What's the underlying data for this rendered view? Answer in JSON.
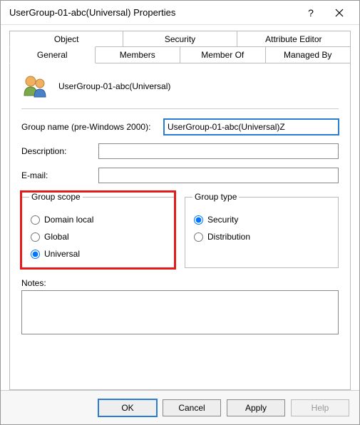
{
  "window": {
    "title": "UserGroup-01-abc(Universal) Properties",
    "help_glyph": "?",
    "close_glyph": "×"
  },
  "tabs": {
    "row1": [
      "Object",
      "Security",
      "Attribute Editor"
    ],
    "row2": [
      "General",
      "Members",
      "Member Of",
      "Managed By"
    ],
    "active": "General"
  },
  "header": {
    "display_name": "UserGroup-01-abc(Universal)"
  },
  "fields": {
    "group_name_label": "Group name (pre-Windows 2000):",
    "group_name_value": "UserGroup-01-abc(Universal)Z",
    "description_label": "Description:",
    "description_value": "",
    "email_label": "E-mail:",
    "email_value": ""
  },
  "scope": {
    "legend": "Group scope",
    "options": [
      "Domain local",
      "Global",
      "Universal"
    ],
    "selected": "Universal"
  },
  "type": {
    "legend": "Group type",
    "options": [
      "Security",
      "Distribution"
    ],
    "selected": "Security"
  },
  "notes": {
    "label": "Notes:",
    "value": ""
  },
  "buttons": {
    "ok": "OK",
    "cancel": "Cancel",
    "apply": "Apply",
    "help": "Help"
  }
}
